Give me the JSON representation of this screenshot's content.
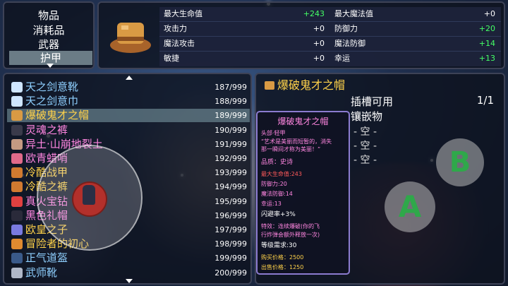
{
  "categories": {
    "items": [
      "物品",
      "消耗品",
      "武器",
      "护甲"
    ],
    "selected_index": 3
  },
  "stats": {
    "left": [
      {
        "name": "最大生命值",
        "value": "+243",
        "positive": true
      },
      {
        "name": "攻击力",
        "value": "+0",
        "positive": false
      },
      {
        "name": "魔法攻击",
        "value": "+0",
        "positive": false
      },
      {
        "name": "敏捷",
        "value": "+0",
        "positive": false
      }
    ],
    "right": [
      {
        "name": "最大魔法值",
        "value": "+0",
        "positive": false
      },
      {
        "name": "防御力",
        "value": "+20",
        "positive": true
      },
      {
        "name": "魔法防御",
        "value": "+14",
        "positive": true
      },
      {
        "name": "幸运",
        "value": "+13",
        "positive": true
      }
    ]
  },
  "items": [
    {
      "name": "天之剑意靴",
      "count": "187/999",
      "color": "#8fd0ff",
      "icon_color": "#cfe6ff"
    },
    {
      "name": "天之剑意巾",
      "count": "188/999",
      "color": "#8fd0ff",
      "icon_color": "#cfe6ff"
    },
    {
      "name": "爆破鬼才之帽",
      "count": "189/999",
      "color": "#ffd24a",
      "icon_color": "#d99a44"
    },
    {
      "name": "灵魂之裤",
      "count": "190/999",
      "color": "#ff86e0",
      "icon_color": "#3a3a4a"
    },
    {
      "name": "异土·山崩地裂土",
      "count": "191/999",
      "color": "#ff86e0",
      "icon_color": "#c49a82"
    },
    {
      "name": "欧青蜡哨",
      "count": "192/999",
      "color": "#ff86e0",
      "icon_color": "#e06a8a"
    },
    {
      "name": "冷酷战甲",
      "count": "193/999",
      "color": "#ffd24a",
      "icon_color": "#d07a30"
    },
    {
      "name": "冷酷之裤",
      "count": "194/999",
      "color": "#ffd24a",
      "icon_color": "#d07a30"
    },
    {
      "name": "真火宝钻",
      "count": "195/999",
      "color": "#ff86e0",
      "icon_color": "#e04040"
    },
    {
      "name": "黑色礼帽",
      "count": "196/999",
      "color": "#ff86e0",
      "icon_color": "#2a2a3a"
    },
    {
      "name": "欧皇之子",
      "count": "197/999",
      "color": "#ffd24a",
      "icon_color": "#7a7ae0"
    },
    {
      "name": "冒险者的初心",
      "count": "198/999",
      "color": "#ffd24a",
      "icon_color": "#e08a30"
    },
    {
      "name": "正气道盔",
      "count": "199/999",
      "color": "#8fd0ff",
      "icon_color": "#3a5a8a"
    },
    {
      "name": "武师靴",
      "count": "200/999",
      "color": "#8fd0ff",
      "icon_color": "#b0b8c8"
    }
  ],
  "selected_item_index": 2,
  "detail": {
    "title": "爆破鬼才之帽",
    "slot_label": "插槽可用",
    "slot_count": "1/1",
    "gem_label": "镶嵌物",
    "empty_slots": [
      "- 空 -",
      "- 空 -",
      "- 空 -"
    ],
    "card": {
      "title": "爆破鬼才之帽",
      "type": "头部·轻甲",
      "desc1": "“艺术是美丽而短暂的，消失",
      "desc2": "那一瞬间才称为美丽！”",
      "quality": "品质：史诗",
      "hp": "最大生命值:243",
      "def": "防御力:20",
      "mdef": "魔法防御:14",
      "luck": "幸运:13",
      "dodge": "闪避率+3%",
      "effect1": "特效：连续爆破(你的飞",
      "effect2": "行炸弹会额外释放一次)",
      "level": "等级需求:30",
      "buy": "购买价格：2500",
      "sell": "出售价格：1250"
    }
  },
  "controls": {
    "b_label": "B",
    "a_label": "A"
  }
}
